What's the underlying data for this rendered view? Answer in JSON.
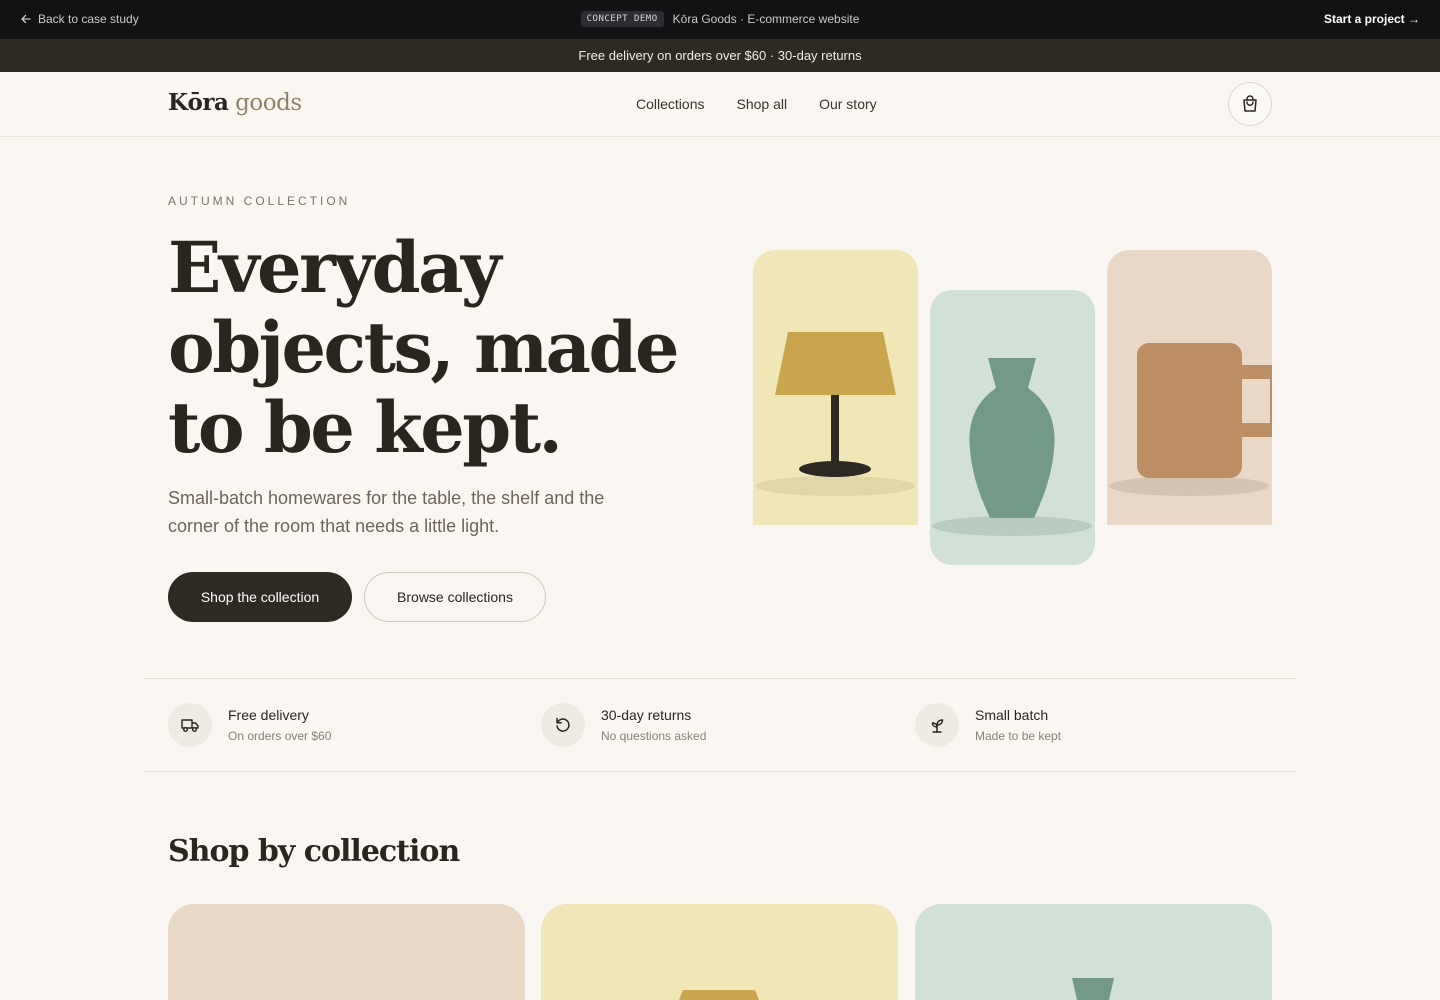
{
  "topbar": {
    "back_label": "Back to case study",
    "badge": "CONCEPT DEMO",
    "center_text": "Kōra Goods · E-commerce website",
    "cta_label": "Start a project →"
  },
  "promo": {
    "text": "Free delivery on orders over $60 · 30-day returns"
  },
  "header": {
    "logo_part1": "Kōra",
    "logo_part2": "goods",
    "nav": [
      "Collections",
      "Shop all",
      "Our story"
    ]
  },
  "hero": {
    "eyebrow": "AUTUMN COLLECTION",
    "headline_lines": [
      "Everyday",
      "objects, made",
      "to be kept."
    ],
    "subtitle": "Small-batch homewares for the table, the shelf and the corner of the room that needs a little light.",
    "primary_label": "Shop the collection",
    "secondary_label": "Browse collections"
  },
  "features": [
    {
      "icon": "truck-icon",
      "title": "Free delivery",
      "subtitle": "On orders over $60"
    },
    {
      "icon": "refresh-icon",
      "title": "30-day returns",
      "subtitle": "No questions asked"
    },
    {
      "icon": "sprout-icon",
      "title": "Small batch",
      "subtitle": "Made to be kept"
    }
  ],
  "section": {
    "title": "Shop by collection"
  },
  "colors": {
    "dark": "#2e2a23",
    "cream": "#faf7f2",
    "yellow_card": "#f1e6b7",
    "mint_card": "#d1e1d7",
    "peach_card": "#ead8c6",
    "lamp_shade": "#c9a64e",
    "vase": "#729a86",
    "mug": "#bb8e66"
  }
}
